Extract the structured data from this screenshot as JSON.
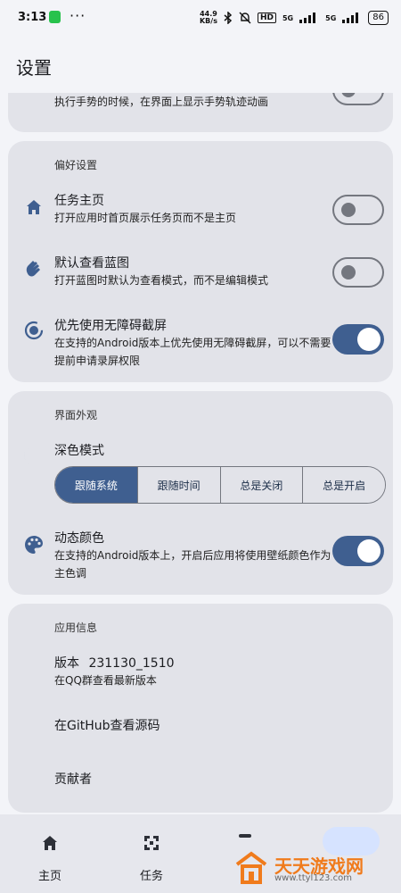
{
  "status_bar": {
    "time": "3:13",
    "dots": "···",
    "speed_value": "44.9",
    "speed_unit": "KB/s",
    "hd_label": "HD",
    "net1": "5G",
    "net2": "5G",
    "battery": "86"
  },
  "header": {
    "title": "设置"
  },
  "top_card": {
    "partial_description": "执行手势的时候，在界面上显示手势轨迹动画"
  },
  "preferences": {
    "section_title": "偏好设置",
    "items": [
      {
        "title": "任务主页",
        "desc": "打开应用时首页展示任务页而不是主页",
        "icon": "home-icon",
        "enabled": false
      },
      {
        "title": "默认查看蓝图",
        "desc": "打开蓝图时默认为查看模式，而不是编辑模式",
        "icon": "hand-wave-icon",
        "enabled": false
      },
      {
        "title": "优先使用无障碍截屏",
        "desc": "在支持的Android版本上优先使用无障碍截屏，可以不需要提前申请录屏权限",
        "icon": "screenshot-icon",
        "enabled": true
      }
    ]
  },
  "appearance": {
    "section_title": "界面外观",
    "dark_mode": {
      "title": "深色模式",
      "icon": "moon-icon",
      "options": [
        "跟随系统",
        "跟随时间",
        "总是关闭",
        "总是开启"
      ],
      "selected": "跟随系统"
    },
    "dynamic_color": {
      "title": "动态颜色",
      "desc": "在支持的Android版本上，开启后应用将使用壁纸颜色作为主色调",
      "icon": "palette-icon",
      "enabled": true
    }
  },
  "app_info": {
    "section_title": "应用信息",
    "version_label": "版本",
    "version_value": "231130_1510",
    "check_update": "在QQ群查看最新版本",
    "source_link": "在GitHub查看源码",
    "contributors": "贡献者"
  },
  "bottom_nav": {
    "items": [
      {
        "label": "主页",
        "icon": "home-icon"
      },
      {
        "label": "任务",
        "icon": "task-icon"
      }
    ]
  },
  "watermark": {
    "title": "天天游戏网",
    "url": "www.ttyl123.com"
  },
  "colors": {
    "accent": "#3f5f90",
    "card": "#e2e3e9",
    "background": "#f3f4f8",
    "watermark": "#f07b1c"
  }
}
